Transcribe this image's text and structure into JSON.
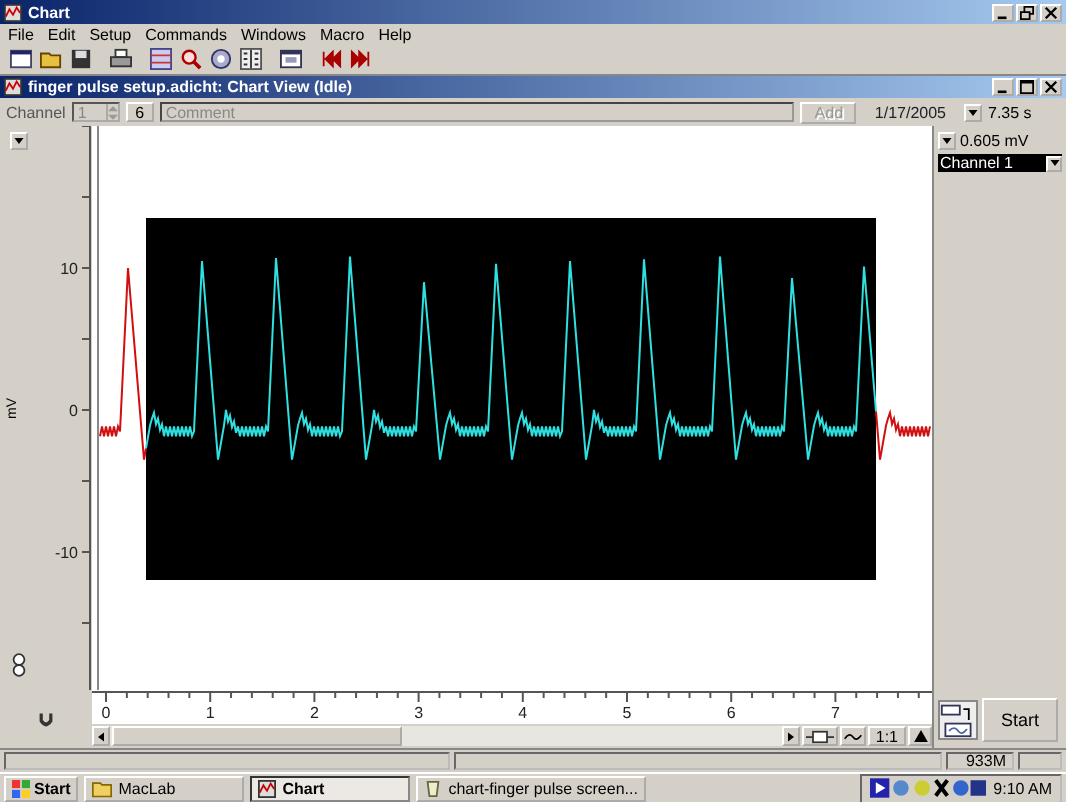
{
  "window": {
    "title": "Chart"
  },
  "menu": [
    "File",
    "Edit",
    "Setup",
    "Commands",
    "Windows",
    "Macro",
    "Help"
  ],
  "document": {
    "title": "finger pulse setup.adicht: Chart View (Idle)"
  },
  "channel_bar": {
    "label": "Channel",
    "channel": "1",
    "count": "6",
    "comment": {
      "placeholder": "Comment"
    },
    "add_button": {
      "label": "Add",
      "disabled": true
    },
    "date": "1/17/2005",
    "duration": "7.35 s"
  },
  "readout": {
    "value": "0.605 mV",
    "channel": "Channel 1"
  },
  "y_axis": {
    "unit": "mV",
    "ticks": [
      "10",
      "0",
      "-10"
    ]
  },
  "x_axis": {
    "ticks": [
      "0",
      "1",
      "2",
      "3",
      "4",
      "5",
      "6",
      "7"
    ]
  },
  "controls": {
    "zoom": "1:1",
    "start": "Start"
  },
  "status_bar": {
    "memory": "933M"
  },
  "taskbar": {
    "start": "Start",
    "items": [
      {
        "label": "MacLab",
        "kind": "folder",
        "selected": false
      },
      {
        "label": "Chart",
        "kind": "app",
        "selected": true
      },
      {
        "label": "chart-finger pulse screen...",
        "kind": "image",
        "selected": false
      }
    ],
    "clock": "9:10 AM"
  }
}
